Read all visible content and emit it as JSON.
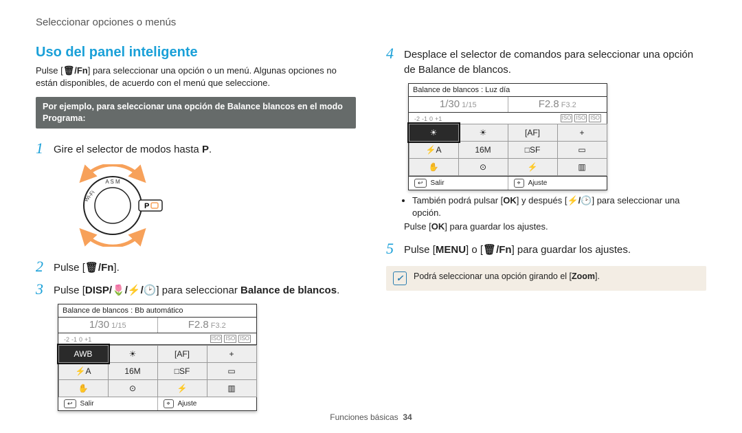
{
  "breadcrumb": "Seleccionar opciones o menús",
  "left": {
    "title": "Uso del panel inteligente",
    "intro_a": "Pulse [",
    "intro_b": "] para seleccionar una opción o un menú. Algunas opciones no están disponibles, de acuerdo con el menú que seleccione.",
    "trash_fn": "🗑/Fn",
    "example": "Por ejemplo, para seleccionar una opción de Balance blancos en el modo Programa:",
    "step1_a": "Gire el selector de modos hasta ",
    "step1_b": ".",
    "mode_P": "P",
    "step2_a": "Pulse [",
    "step2_b": "].",
    "step3_a": "Pulse [",
    "step3_disp": "DISP",
    "step3_mid": "/🌷/⚡/🕑",
    "step3_b": "] para seleccionar ",
    "step3_bold": "Balance de blancos",
    "step3_c": "."
  },
  "right": {
    "step4": "Desplace el selector de comandos para seleccionar una opción de Balance de blancos.",
    "bullet1_a": "También podrá pulsar [",
    "ok": "OK",
    "bullet1_b": "] y después [",
    "flashclk": "⚡/🕑",
    "bullet1_c": "] para seleccionar una opción.",
    "bullet2_a": "Pulse [",
    "bullet2_b": "] para guardar los ajustes.",
    "step5_a": "Pulse [",
    "menu": "MENU",
    "step5_b": "] o [",
    "step5_c": "] para guardar los ajustes.",
    "note": "Podrá seleccionar una opción girando el [",
    "zoom": "Zoom",
    "note_b": "]."
  },
  "screenA": {
    "title": "Balance de blancos : Bb automático",
    "shutter": "1/30",
    "shutter_s": "1/15",
    "aperture": "F2.8",
    "aperture_s": "F3.2",
    "ev_l": "-2",
    "ev_m1": "-1",
    "ev_0": "0",
    "ev_p1": "+1",
    "ev_p2": "",
    "iso1": "ISO",
    "iso2": "ISO",
    "iso3": "ISO",
    "cells": [
      "AWB",
      "☀",
      "[AF]",
      "+",
      "⚡A",
      "16M",
      "□SF",
      "▭",
      "✋",
      "⊙",
      "⚡",
      "▥"
    ],
    "salir": "Salir",
    "ajuste": "Ajuste",
    "kback": "↩",
    "kscroll": "⌖"
  },
  "screenB": {
    "title": "Balance de blancos : Luz día",
    "shutter": "1/30",
    "shutter_s": "1/15",
    "aperture": "F2.8",
    "aperture_s": "F3.2",
    "ev_l": "-2",
    "ev_m1": "-1",
    "ev_0": "0",
    "ev_p1": "+1",
    "ev_p2": "",
    "iso1": "ISO",
    "iso2": "ISO",
    "iso3": "ISO",
    "cells": [
      "☀",
      "☀",
      "[AF]",
      "+",
      "⚡A",
      "16M",
      "□SF",
      "▭",
      "✋",
      "⊙",
      "⚡",
      "▥"
    ],
    "salir": "Salir",
    "ajuste": "Ajuste",
    "kback": "↩",
    "kscroll": "⌖"
  },
  "footer_a": "Funciones básicas",
  "footer_b": "34"
}
